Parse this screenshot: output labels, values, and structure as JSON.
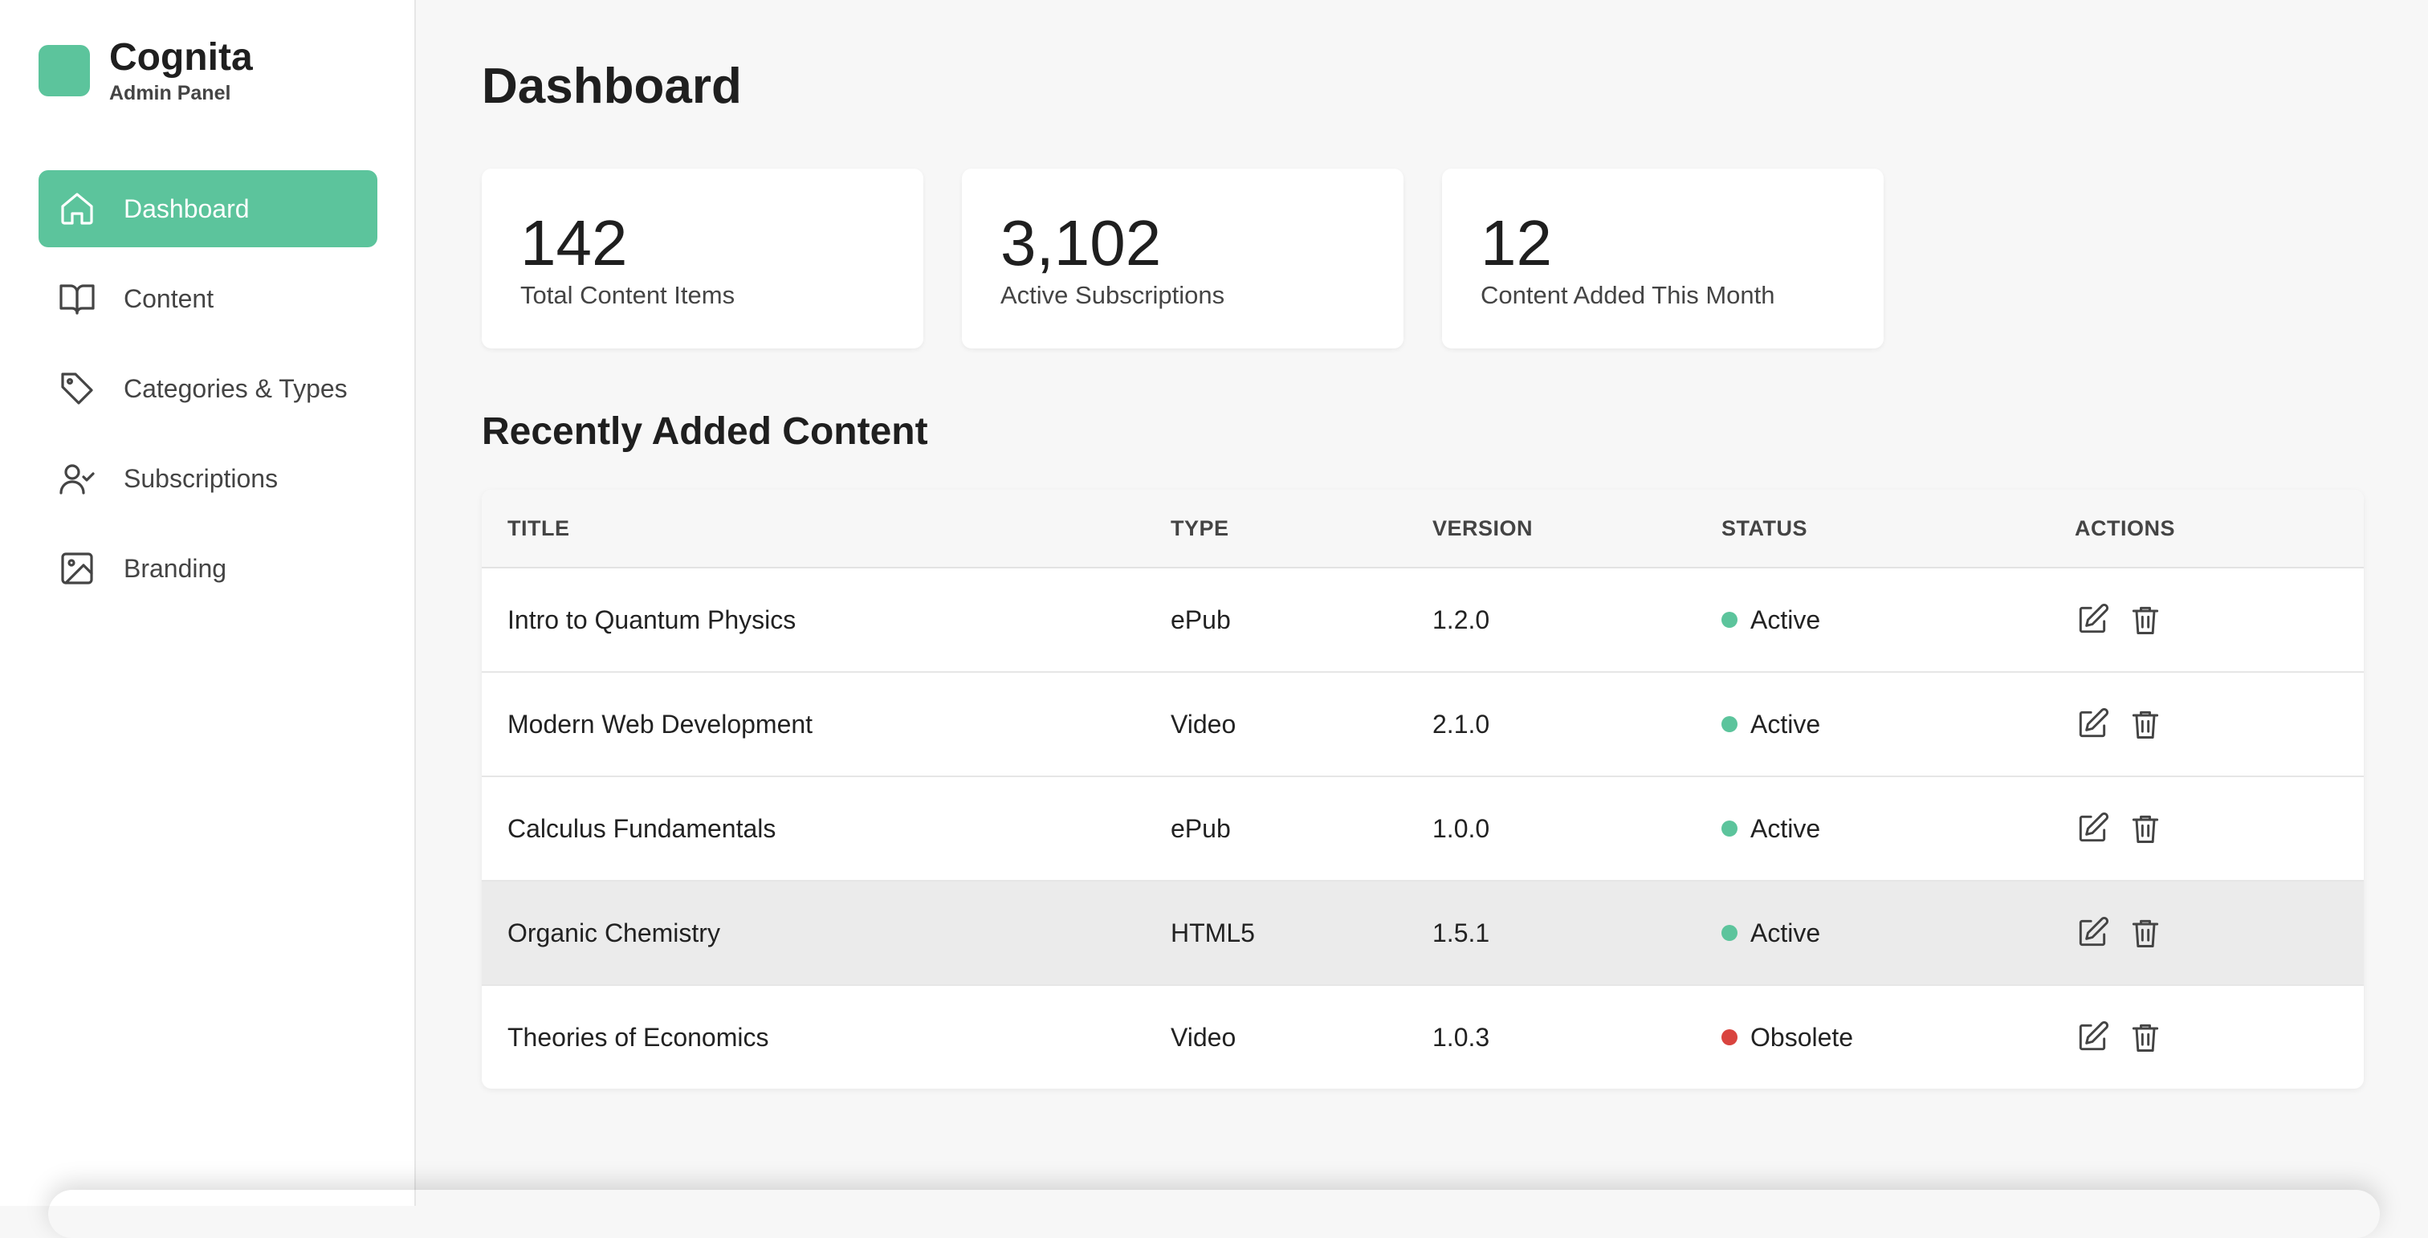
{
  "brand": {
    "name": "Cognita",
    "subtitle": "Admin Panel",
    "color": "#5cc49c"
  },
  "nav": [
    {
      "label": "Dashboard",
      "icon": "home-icon",
      "active": true
    },
    {
      "label": "Content",
      "icon": "book-icon",
      "active": false
    },
    {
      "label": "Categories & Types",
      "icon": "tag-icon",
      "active": false
    },
    {
      "label": "Subscriptions",
      "icon": "user-check-icon",
      "active": false
    },
    {
      "label": "Branding",
      "icon": "image-icon",
      "active": false
    }
  ],
  "page": {
    "title": "Dashboard"
  },
  "stats": [
    {
      "value": "142",
      "label": "Total Content Items"
    },
    {
      "value": "3,102",
      "label": "Active Subscriptions"
    },
    {
      "value": "12",
      "label": "Content Added This Month"
    }
  ],
  "recent": {
    "title": "Recently Added Content",
    "headers": [
      "TITLE",
      "TYPE",
      "VERSION",
      "STATUS",
      "ACTIONS"
    ],
    "rows": [
      {
        "title": "Intro to Quantum Physics",
        "type": "ePub",
        "version": "1.2.0",
        "status": "Active"
      },
      {
        "title": "Modern Web Development",
        "type": "Video",
        "version": "2.1.0",
        "status": "Active"
      },
      {
        "title": "Calculus Fundamentals",
        "type": "ePub",
        "version": "1.0.0",
        "status": "Active"
      },
      {
        "title": "Organic Chemistry",
        "type": "HTML5",
        "version": "1.5.1",
        "status": "Active"
      },
      {
        "title": "Theories of Economics",
        "type": "Video",
        "version": "1.0.3",
        "status": "Obsolete"
      }
    ]
  },
  "colors": {
    "active": "#5cc49c",
    "obsolete": "#d9443f"
  },
  "icons": {
    "edit": "edit-icon",
    "delete": "trash-icon"
  }
}
